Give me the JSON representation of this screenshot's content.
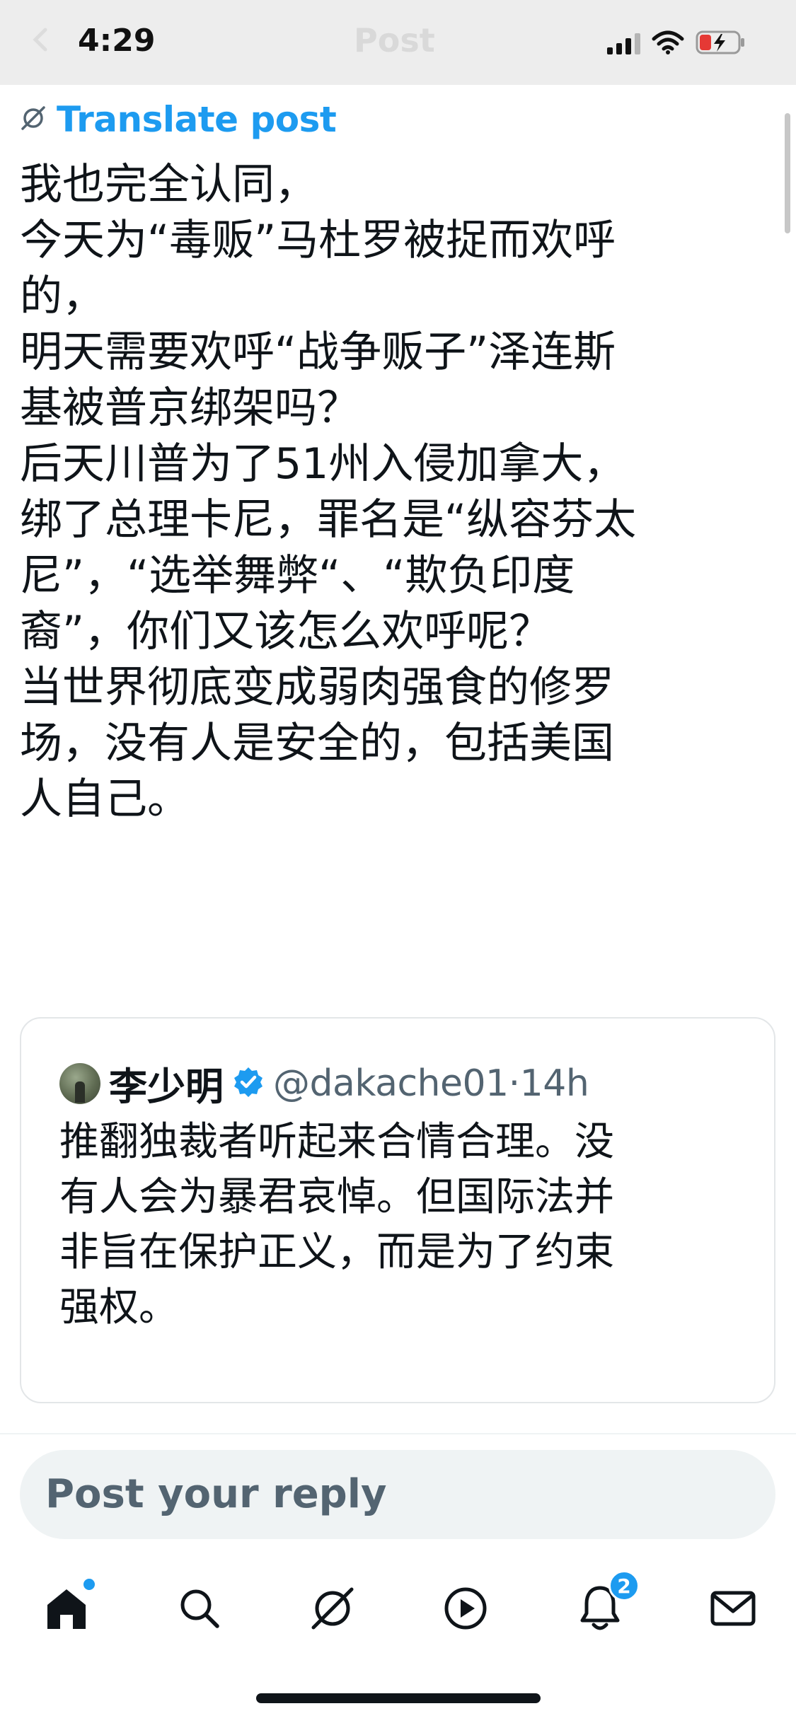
{
  "status_bar": {
    "time": "4:29",
    "ghost_title": "Post"
  },
  "translate": {
    "label": "Translate post",
    "icon": "grok-slash-icon"
  },
  "post": {
    "lines": [
      "我也完全认同，",
      "今天为“毒贩”马杜罗被捉而欢呼",
      "的，",
      "明天需要欢呼“战争贩子”泽连斯",
      "基被普京绑架吗？",
      "后天川普为了51州入侵加拿大，",
      "绑了总理卡尼，罪名是“纵容芬太",
      "尼”，“选举舞弊“、“欺负印度",
      "裔”，你们又该怎么欢呼呢？",
      "当世界彻底变成弱肉强食的修罗",
      "场，没有人是安全的，包括美国",
      "人自己。"
    ]
  },
  "quote": {
    "name": "李少明",
    "handle_time": "@dakache01·14h",
    "verified_icon": "verified-badge-icon",
    "lines": [
      "推翻独裁者听起来合情合理。没",
      "有人会为暴君哀悼。但国际法并",
      "非旨在保护正义，而是为了约束",
      "强权。"
    ]
  },
  "reply": {
    "placeholder": "Post your reply"
  },
  "tab_bar": {
    "items": [
      "home-icon",
      "search-icon",
      "grok-icon",
      "video-icon",
      "notifications-icon",
      "messages-icon"
    ],
    "notifications_badge": "2"
  },
  "colors": {
    "accent": "#1d9bf0",
    "text": "#0f1419",
    "secondary": "#536471",
    "reply_bg": "#eff3f4"
  }
}
